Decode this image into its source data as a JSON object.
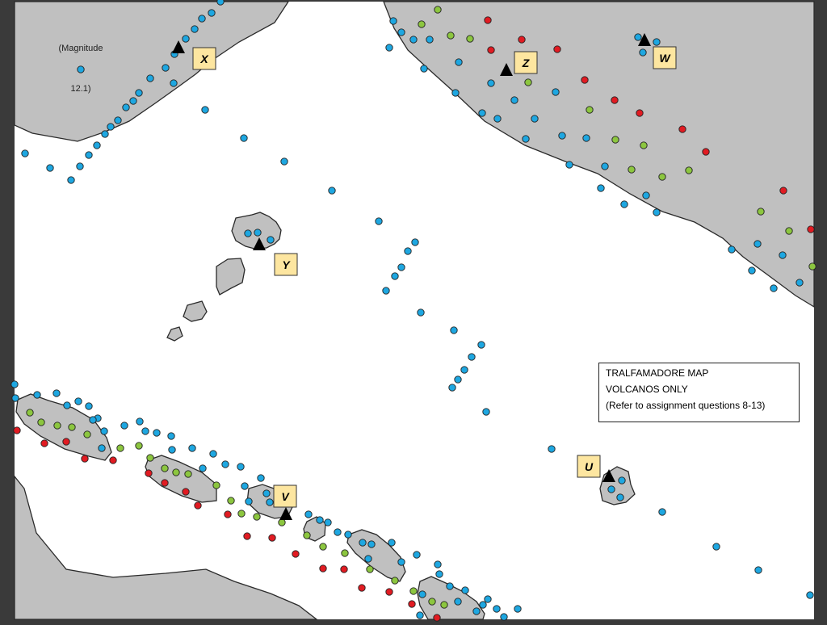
{
  "legend": {
    "line1": "TRALFAMADORE MAP",
    "line2": "VOLCANOS ONLY",
    "line3": "(Refer to assignment questions 8-13)"
  },
  "annotation": {
    "line1": "(Magnitude",
    "line2": "12.1)"
  },
  "volcano_labels": [
    "X",
    "Y",
    "Z",
    "W",
    "U",
    "V"
  ],
  "colors": {
    "land": "#c0c0c0",
    "ocean": "#ffffff",
    "label_box": "#fde6a0",
    "dot_blue": "#1ea7e1",
    "dot_green": "#8cc63f",
    "dot_red": "#e11b22",
    "volcano": "#000000"
  }
}
